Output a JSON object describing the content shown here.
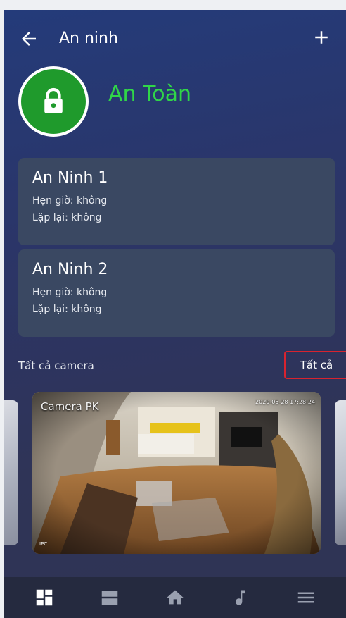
{
  "header": {
    "title": "An ninh",
    "back_icon": "arrow-left-icon",
    "add_icon": "plus-icon"
  },
  "status": {
    "icon": "lock-icon",
    "label": "An Toàn",
    "color": "#30d648"
  },
  "scenes": [
    {
      "name": "An Ninh 1",
      "schedule": "Hẹn giờ: không",
      "repeat": "Lặp lại: không"
    },
    {
      "name": "An Ninh 2",
      "schedule": "Hẹn giờ: không",
      "repeat": "Lặp lại: không"
    }
  ],
  "cameras": {
    "section_label": "Tất cả camera",
    "view_all_label": "Tất cả",
    "items": [
      {
        "name": "Camera PK",
        "timestamp": "2020-05-28 17:28:24",
        "brand": "IPC"
      }
    ]
  },
  "bottom_nav": [
    {
      "icon": "dashboard-icon",
      "active": true
    },
    {
      "icon": "list-icon",
      "active": false
    },
    {
      "icon": "home-icon",
      "active": false
    },
    {
      "icon": "music-note-icon",
      "active": false
    },
    {
      "icon": "menu-icon",
      "active": false
    }
  ],
  "colors": {
    "accent_green": "#1f9a2c",
    "card_bg": "#3a4862",
    "highlight_border": "#d8232f"
  }
}
